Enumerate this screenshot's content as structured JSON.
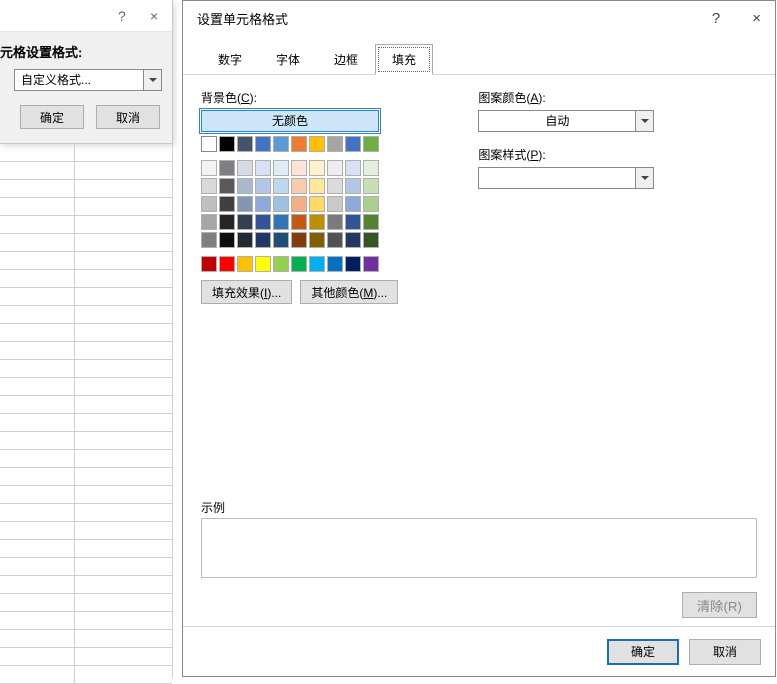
{
  "bg": {
    "help": "?",
    "close": "×",
    "heading": "元格设置格式:",
    "select_value": "自定义格式...",
    "ok": "确定",
    "cancel": "取消"
  },
  "dialog": {
    "title": "设置单元格格式",
    "help": "?",
    "close": "×",
    "tabs": [
      "数字",
      "字体",
      "边框",
      "填充"
    ],
    "active_tab": 3,
    "bgcolor_label_pre": "背景色(",
    "bgcolor_label_u": "C",
    "bgcolor_label_post": "):",
    "nocolor": "无颜色",
    "fill_effects_pre": "填充效果(",
    "fill_effects_u": "I",
    "fill_effects_post": ")...",
    "more_colors_pre": "其他颜色(",
    "more_colors_u": "M",
    "more_colors_post": ")...",
    "pattern_color_label_pre": "图案颜色(",
    "pattern_color_label_u": "A",
    "pattern_color_label_post": "):",
    "pattern_color_value": "自动",
    "pattern_style_label_pre": "图案样式(",
    "pattern_style_label_u": "P",
    "pattern_style_label_post": "):",
    "pattern_style_value": "",
    "sample_label": "示例",
    "clear": "清除(R)",
    "ok": "确定",
    "cancel": "取消"
  },
  "palette": {
    "theme_row0": [
      "#ffffff",
      "#000000",
      "#44546a",
      "#4472c4",
      "#5b9bd5",
      "#ed7d31",
      "#ffc000",
      "#a5a5a5",
      "#4472c4",
      "#70ad47"
    ],
    "theme_shades": [
      [
        "#f2f2f2",
        "#808080",
        "#d6dce5",
        "#d9e1f2",
        "#deeaf6",
        "#fce4d6",
        "#fff2cc",
        "#ededed",
        "#d9e1f2",
        "#e2efda"
      ],
      [
        "#d9d9d9",
        "#595959",
        "#acb9ca",
        "#b4c6e7",
        "#bdd7ee",
        "#f8cbad",
        "#ffe699",
        "#dbdbdb",
        "#b4c6e7",
        "#c6e0b4"
      ],
      [
        "#bfbfbf",
        "#404040",
        "#8497b0",
        "#8ea9db",
        "#9bc2e6",
        "#f4b084",
        "#ffd966",
        "#c9c9c9",
        "#8ea9db",
        "#a9d08e"
      ],
      [
        "#a6a6a6",
        "#262626",
        "#333f4f",
        "#305496",
        "#2f75b5",
        "#c65911",
        "#bf8f00",
        "#7b7b7b",
        "#305496",
        "#548235"
      ],
      [
        "#808080",
        "#0d0d0d",
        "#222b35",
        "#203764",
        "#1f4e78",
        "#833c0c",
        "#806000",
        "#525252",
        "#203764",
        "#375623"
      ]
    ],
    "standard": [
      "#c00000",
      "#ff0000",
      "#ffc000",
      "#ffff00",
      "#92d050",
      "#00b050",
      "#00b0f0",
      "#0070c0",
      "#002060",
      "#7030a0"
    ]
  }
}
